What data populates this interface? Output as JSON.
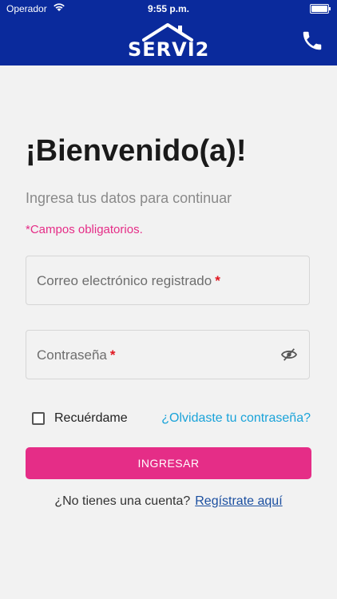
{
  "status_bar": {
    "carrier": "Operador",
    "time": "9:55 p.m."
  },
  "header": {
    "logo_text": "SERVI2",
    "phone_icon": "phone-icon"
  },
  "login": {
    "title": "¡Bienvenido(a)!",
    "subtitle": "Ingresa tus datos para continuar",
    "required_note": "*Campos obligatorios.",
    "email_label": "Correo electrónico registrado",
    "password_label": "Contraseña",
    "required_mark": "*",
    "remember_label": "Recuérdame",
    "forgot_label": "¿Olvidaste tu contraseña?",
    "submit_label": "INGRESAR",
    "signup_prompt": "¿No tienes una cuenta?",
    "signup_link": "Regístrate aquí"
  },
  "colors": {
    "brand_blue": "#0a2a9c",
    "accent_pink": "#e52d87",
    "link_blue": "#1aa3d9",
    "required_red": "#e0161f"
  }
}
